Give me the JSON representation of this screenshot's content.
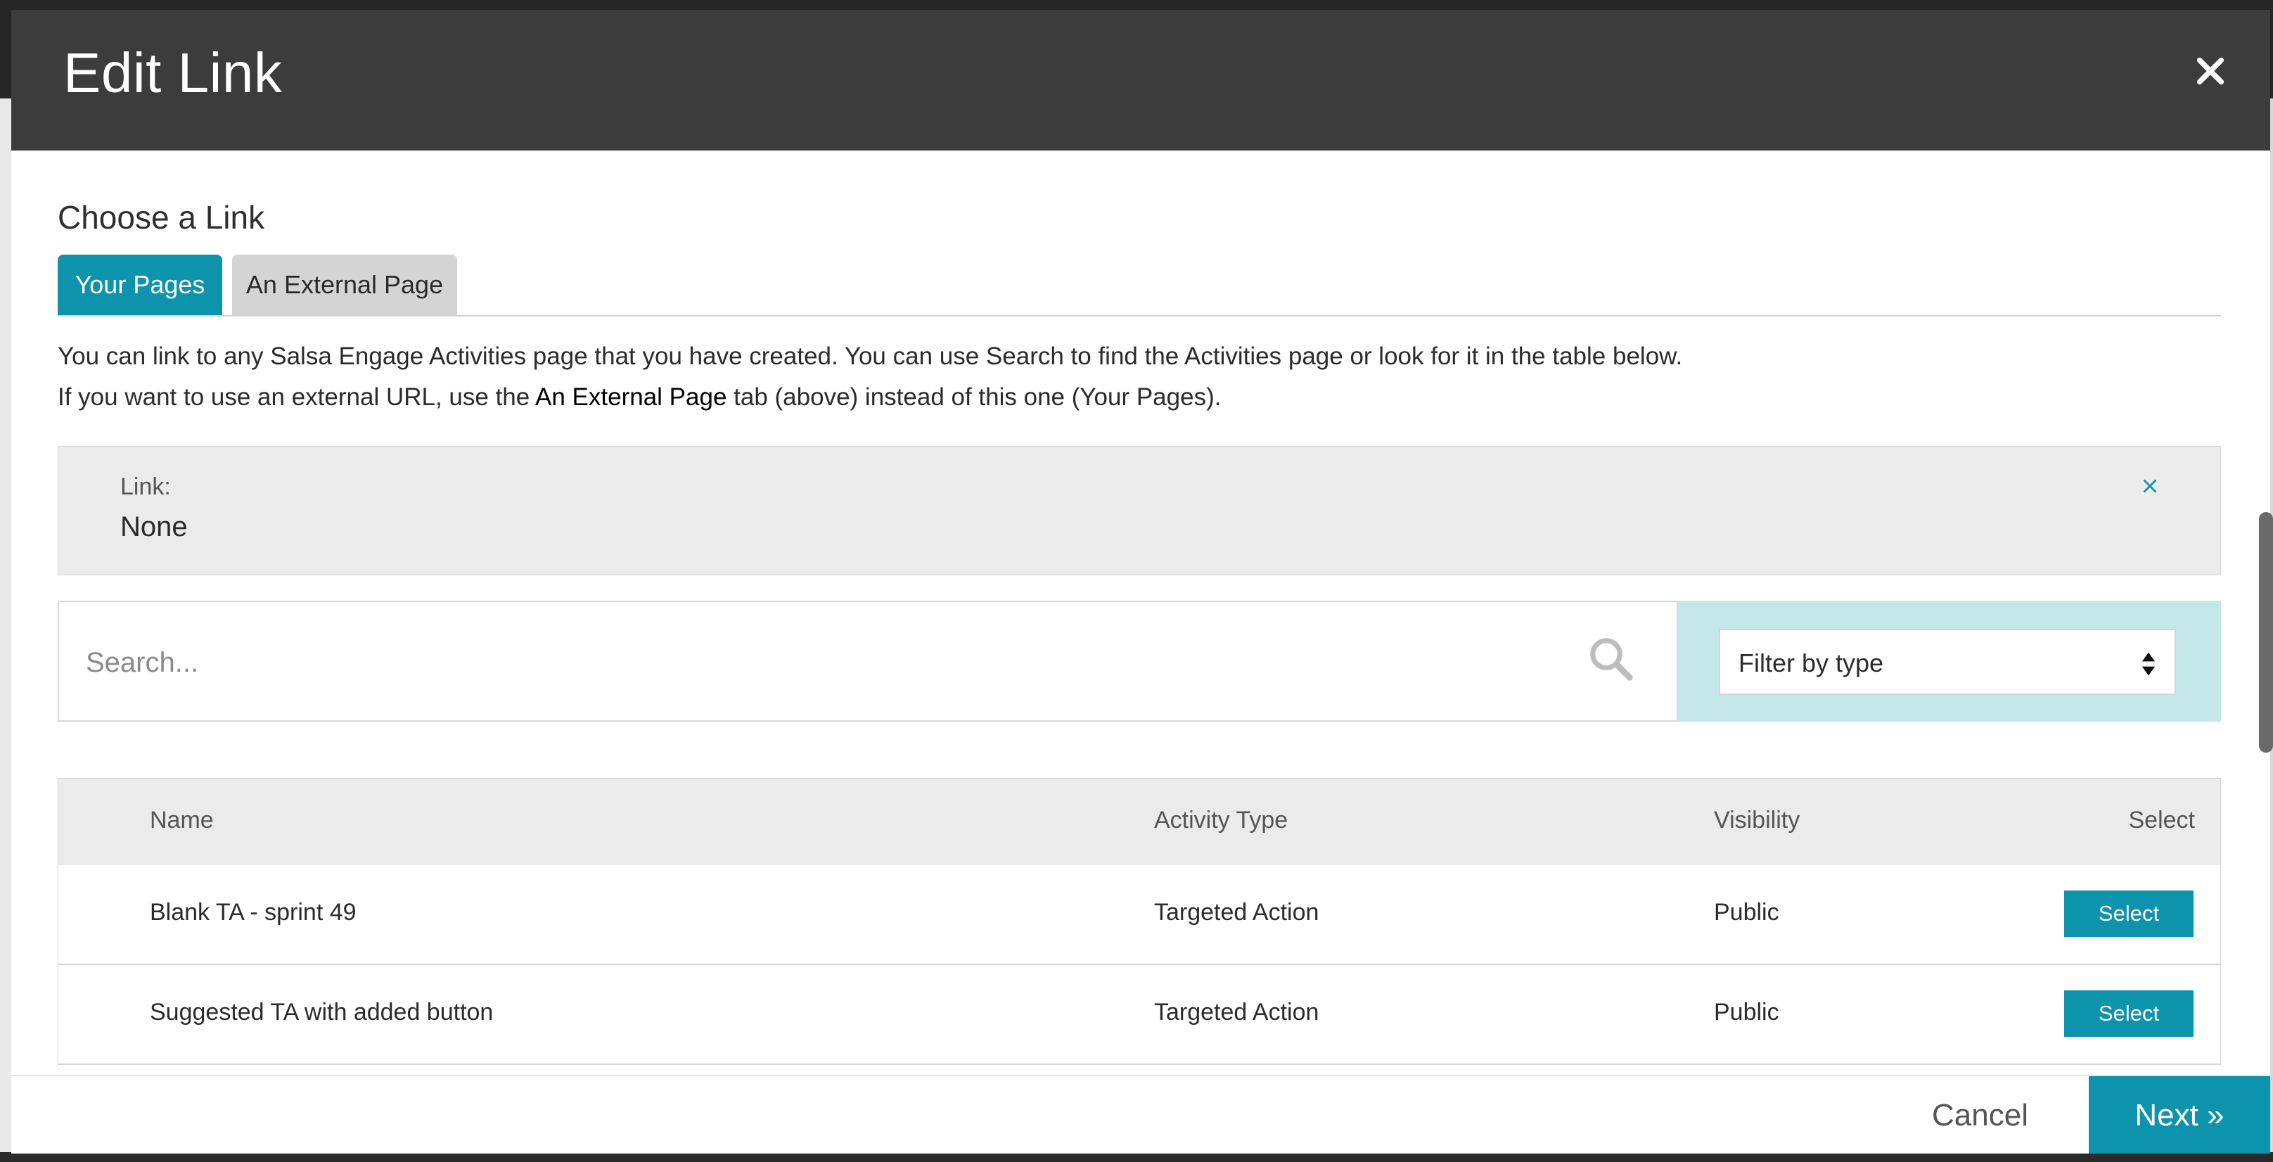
{
  "modal": {
    "title": "Edit Link",
    "close_icon": "close-icon"
  },
  "section": {
    "title": "Choose a Link"
  },
  "tabs": [
    {
      "label": "Your Pages",
      "active": true
    },
    {
      "label": "An External Page",
      "active": false
    }
  ],
  "intro": {
    "line1": "You can link to any Salsa Engage Activities page that you have created. You can use Search to find the Activities page or look for it in the table below.",
    "line2_prefix": "If you want to use an external URL, use the ",
    "line2_strong": "An External Page",
    "line2_suffix": " tab (above) instead of this one (Your Pages)."
  },
  "link": {
    "label": "Link:",
    "value": "None",
    "clear_icon": "clear-link-icon"
  },
  "search": {
    "placeholder": "Search...",
    "value": "",
    "icon": "search-icon"
  },
  "filter": {
    "selected": "Filter by type"
  },
  "table": {
    "headers": {
      "name": "Name",
      "type": "Activity Type",
      "visibility": "Visibility",
      "select": "Select"
    },
    "rows": [
      {
        "name": "Blank TA - sprint 49",
        "type": "Targeted Action",
        "visibility": "Public",
        "action": "Select"
      },
      {
        "name": "Suggested TA with added button",
        "type": "Targeted Action",
        "visibility": "Public",
        "action": "Select"
      }
    ]
  },
  "footer": {
    "cancel": "Cancel",
    "next": "Next »"
  },
  "colors": {
    "header_bg": "#3c3c3c",
    "accent": "#0e93ad",
    "filter_bg": "#c4e8ea",
    "panel_bg": "#ebebeb"
  }
}
